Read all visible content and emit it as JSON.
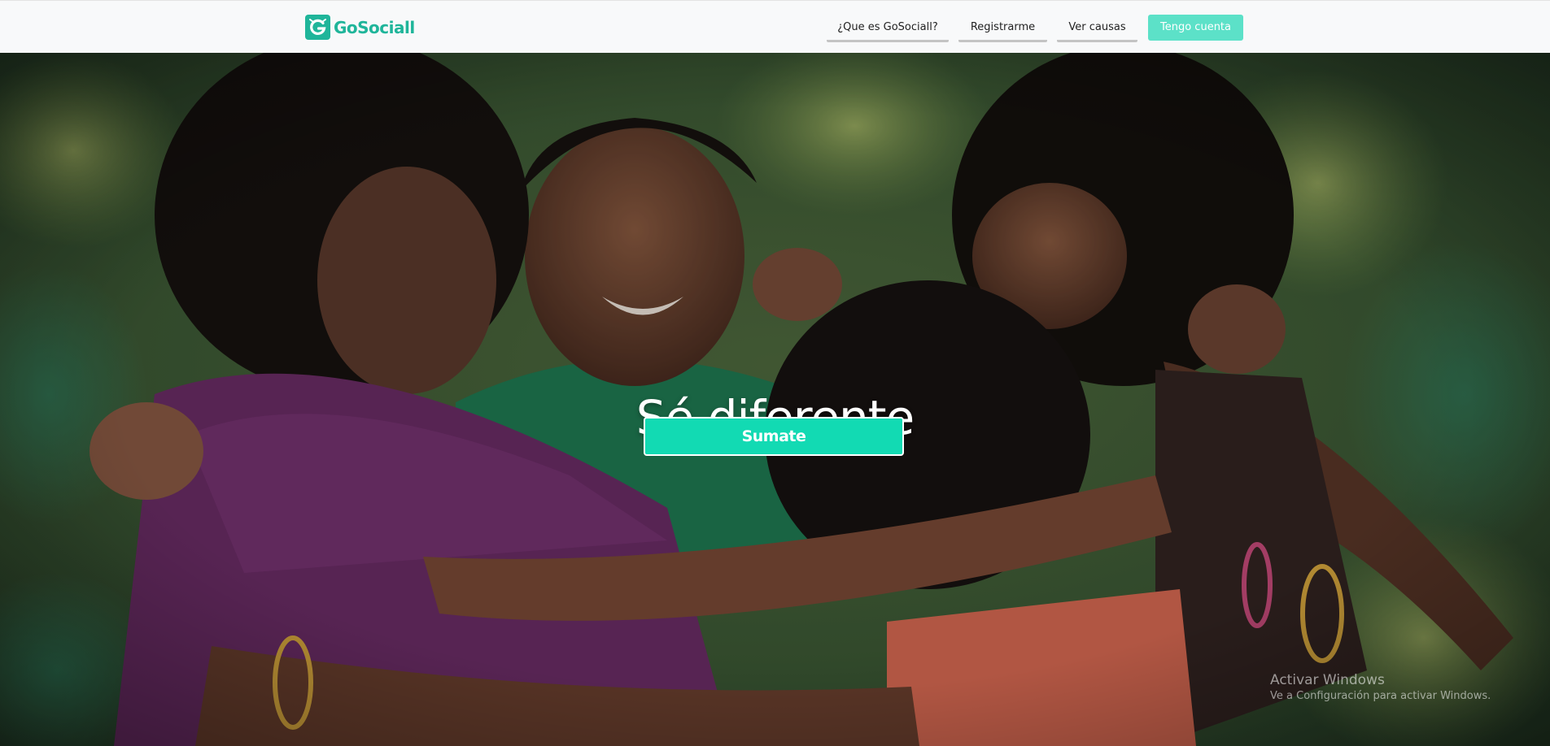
{
  "navbar": {
    "brand_name": "GoSociall",
    "links": [
      {
        "label": "¿Que es GoSociall?"
      },
      {
        "label": "Registrarme"
      },
      {
        "label": "Ver causas"
      }
    ],
    "cta_label": "Tengo cuenta"
  },
  "hero": {
    "title": "Sé diferente",
    "button_label": "Sumate"
  },
  "watermark": {
    "title": "Activar Windows",
    "subtitle": "Ve a Configuración para activar Windows."
  },
  "colors": {
    "brand": "#1fb59a",
    "cta": "#5ce1c8",
    "hero_button": "#12dab3",
    "navbar_bg": "#f8f9fa"
  },
  "icons": {
    "brand_logo": "gosociall-logo-icon"
  }
}
